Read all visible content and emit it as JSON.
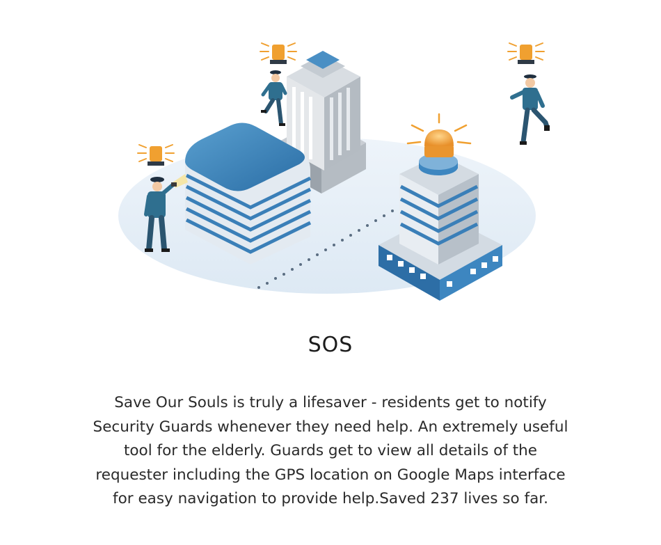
{
  "title": "SOS",
  "description": {
    "lines": [
      "Save Our Souls is truly a lifesaver - residents get to notify",
      "Security Guards whenever they need help.  An extremely useful",
      "tool for the elderly. Guards get to view all details of the",
      "requester including the GPS location on Google Maps interface",
      "for easy navigation to provide help.Saved 237 lives so far."
    ]
  },
  "illustration": {
    "icons": [
      "alarm-siren-icon",
      "security-guard-icon",
      "office-tower-icon",
      "rounded-office-building-icon",
      "hospital-building-icon"
    ]
  },
  "colors": {
    "accent_blue": "#2d7ab3",
    "siren_orange": "#f2a43a",
    "ground": "#e6f0f8",
    "text": "#2a2a2a"
  }
}
